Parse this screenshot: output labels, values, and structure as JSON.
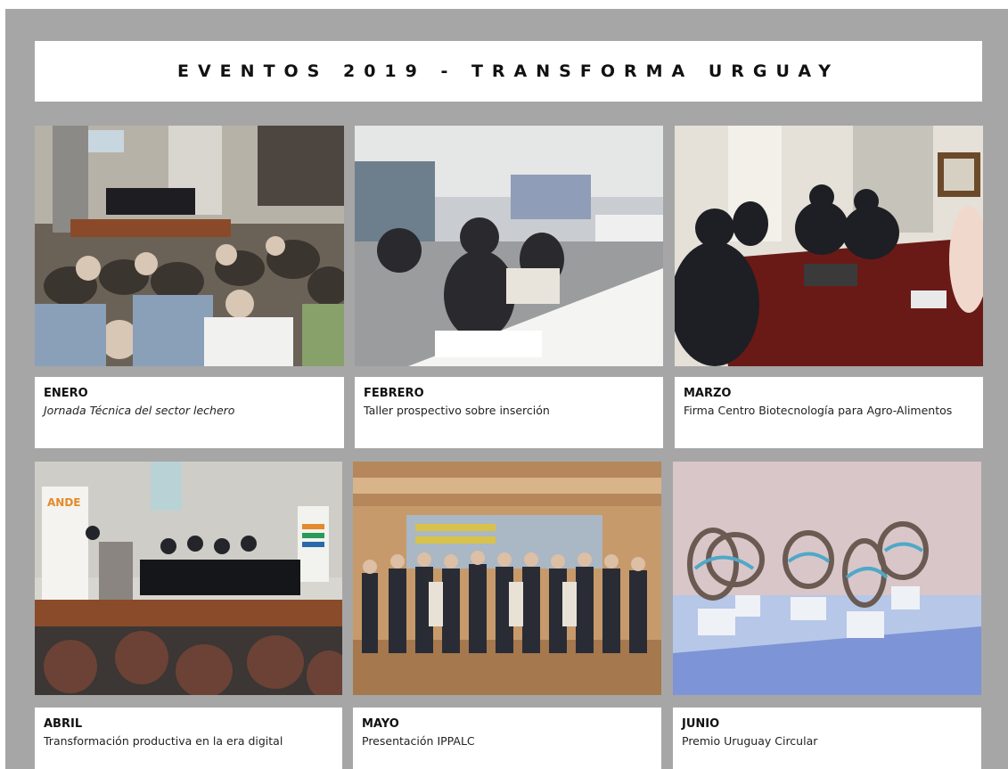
{
  "header": {
    "title": "EVENTOS 2019 - TRANSFORMA URGUAY"
  },
  "events": [
    {
      "month": "ENERO",
      "description": "Jornada Técnica del sector lechero",
      "italic": true,
      "photo": "conference-room-audience-photo"
    },
    {
      "month": "FEBRERO",
      "description": "Taller prospectivo sobre inserción",
      "italic": false,
      "photo": "workshop-meeting-photo"
    },
    {
      "month": "MARZO",
      "description": "Firma Centro Biotecnología para Agro-Alimentos",
      "italic": false,
      "photo": "signing-meeting-photo"
    },
    {
      "month": "ABRIL",
      "description": "Transformación productiva en la era digital",
      "italic": false,
      "photo": "auditorium-panel-photo"
    },
    {
      "month": "MAYO",
      "description": "Presentación IPPALC",
      "italic": false,
      "photo": "group-photo"
    },
    {
      "month": "JUNIO",
      "description": "Premio Uruguay Circular",
      "italic": false,
      "photo": "award-trophies-photo"
    }
  ],
  "photo_labels": {
    "ande": "ANDE"
  }
}
